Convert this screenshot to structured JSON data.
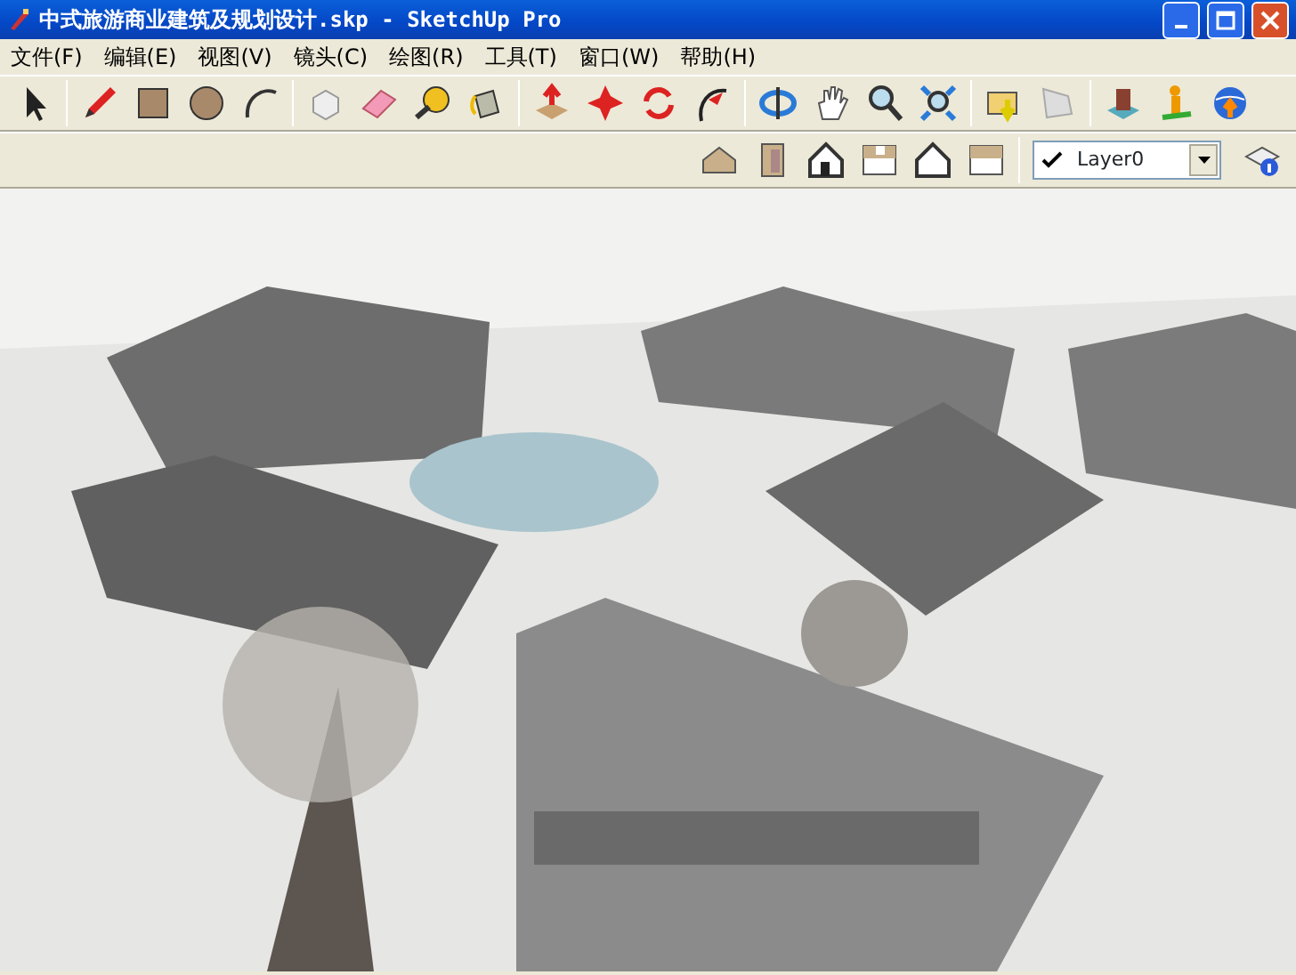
{
  "window": {
    "title": "中式旅游商业建筑及规划设计.skp - SketchUp Pro"
  },
  "menu": [
    {
      "label": "文件(F)"
    },
    {
      "label": "编辑(E)"
    },
    {
      "label": "视图(V)"
    },
    {
      "label": "镜头(C)"
    },
    {
      "label": "绘图(R)"
    },
    {
      "label": "工具(T)"
    },
    {
      "label": "窗口(W)"
    },
    {
      "label": "帮助(H)"
    }
  ],
  "layer_selector": {
    "value": "Layer0"
  }
}
